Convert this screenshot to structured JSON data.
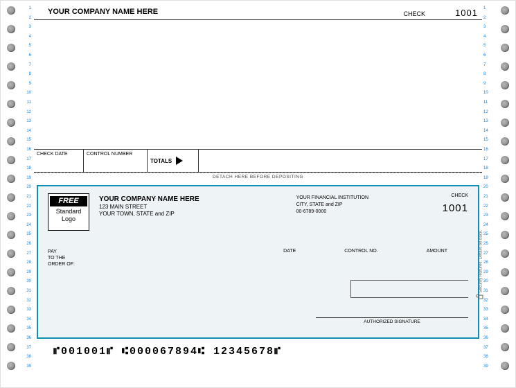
{
  "stub": {
    "company_name": "YOUR COMPANY NAME HERE",
    "check_label": "CHECK",
    "check_number": "1001",
    "fields": {
      "check_date": "CHECK DATE",
      "control_number": "CONTROL NUMBER",
      "totals": "TOTALS"
    },
    "detach_text": "DETACH HERE BEFORE DEPOSITING"
  },
  "check": {
    "logo": {
      "free": "FREE",
      "line1": "Standard",
      "line2": "Logo"
    },
    "company": {
      "name": "YOUR COMPANY NAME HERE",
      "street": "123 MAIN STREET",
      "city": "YOUR TOWN, STATE and ZIP"
    },
    "bank": {
      "name": "YOUR FINANCIAL INSTITUTION",
      "city": "CITY, STATE and ZIP",
      "routing_display": "00-6789-0000"
    },
    "check_label": "CHECK",
    "check_number": "1001",
    "labels": {
      "pay": "PAY",
      "order_of": "TO THE\nORDER OF:",
      "date": "DATE",
      "control_no": "CONTROL NO.",
      "amount": "AMOUNT",
      "authorized_signature": "AUTHORIZED SIGNATURE"
    },
    "security_text": "Security features. Details on back.",
    "micr": "⑈001001⑈  ⑆000067894⑆  12345678⑈"
  },
  "ruler_numbers": [
    1,
    2,
    3,
    4,
    5,
    6,
    7,
    8,
    9,
    10,
    11,
    12,
    13,
    14,
    15,
    16,
    17,
    18,
    19,
    20,
    21,
    22,
    23,
    24,
    25,
    26,
    27,
    28,
    29,
    30,
    31,
    32,
    33,
    34,
    35,
    36,
    37,
    38,
    39
  ]
}
